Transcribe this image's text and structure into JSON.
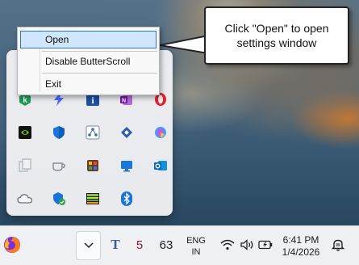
{
  "callout": {
    "text_line1": "Click \"Open\" to open",
    "text_line2": "settings window"
  },
  "context_menu": {
    "items": [
      {
        "label": "Open",
        "highlighted": true
      },
      {
        "label": "Disable ButterScroll",
        "highlighted": false
      },
      {
        "label": "Exit",
        "highlighted": false
      }
    ]
  },
  "tray_icons": [
    "kaspersky-icon",
    "power-automate-icon",
    "intel-graphics-icon",
    "onenote-icon",
    "opera-icon",
    "nvidia-icon",
    "windows-security-icon",
    "network-share-icon",
    "sharex-icon",
    "copilot-icon",
    "clipboard-manager-icon",
    "teacup-icon",
    "app-palette-icon",
    "display-monitor-icon",
    "outlook-icon",
    "onedrive-icon",
    "security-check-icon",
    "terminal-app-icon",
    "bluetooth-icon"
  ],
  "taskbar": {
    "app_text_t": "T",
    "app_badge_5": "5",
    "app_badge_63": "63",
    "lang_line1": "ENG",
    "lang_line2": "IN",
    "time": "6:41 PM",
    "date": "1/4/2026"
  },
  "colors": {
    "menu_highlight": "#d0e6fb",
    "menu_highlight_border": "#2d73c6",
    "taskbar": "#eef0f4"
  }
}
